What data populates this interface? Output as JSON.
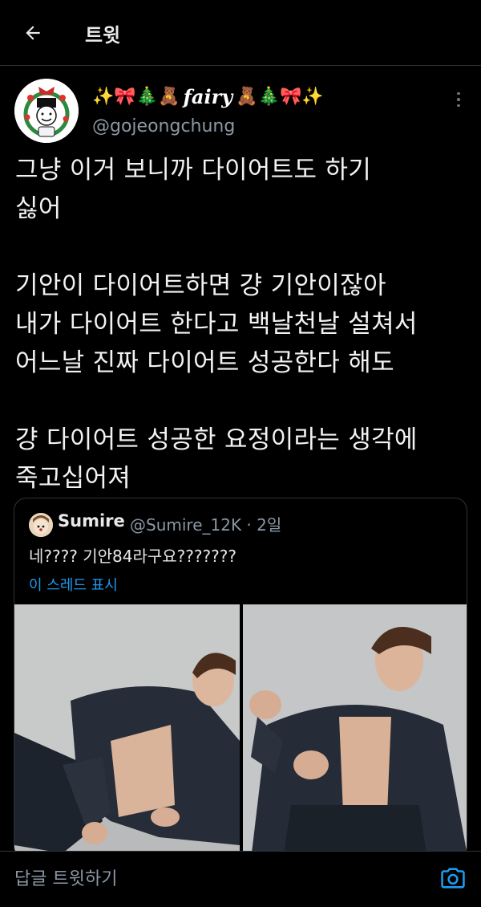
{
  "header": {
    "title": "트윗"
  },
  "author": {
    "name_prefix": "✨🎀🎄🧸",
    "name_text": "fairy",
    "name_suffix": "🧸🎄🎀✨",
    "handle": "@gojeongchung"
  },
  "tweet": {
    "text": "그냥 이거 보니까 다이어트도 하기\n싫어\n\n기안이 다이어트하면 걍 기안이잖아\n내가 다이어트 한다고 백날천날 설쳐서\n어느날 진짜 다이어트 성공한다 해도\n\n걍 다이어트 성공한 요정이라는 생각에\n죽고십어져"
  },
  "quote": {
    "name": "Sumire",
    "handle": "@Sumire_12K",
    "separator": "·",
    "time": "2일",
    "text": "네???? 기안84라구요???????",
    "thread_link": "이 스레드 표시"
  },
  "reply": {
    "placeholder": "답글 트윗하기"
  },
  "colors": {
    "background": "#000000",
    "link": "#1d9bf0",
    "secondary": "#8b98a5",
    "border": "#2f3336"
  },
  "icons": {
    "back": "arrow-left-icon",
    "more": "more-vertical-icon",
    "camera": "camera-icon"
  }
}
